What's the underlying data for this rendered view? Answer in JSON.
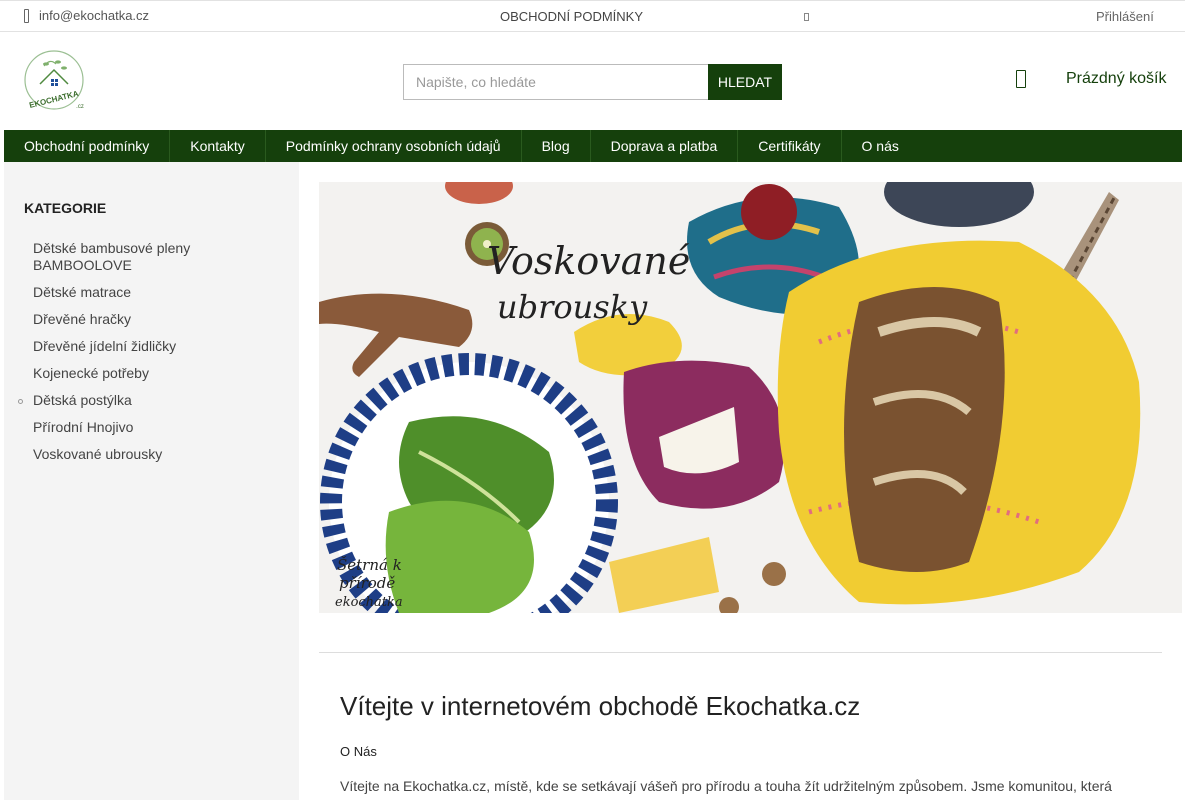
{
  "topbar": {
    "email": "info@ekochatka.cz",
    "terms_link": "OBCHODNÍ PODMÍNKY",
    "login": "Přihlášení"
  },
  "header": {
    "logo_text": "EKOCHATKA",
    "logo_suffix": ".cz",
    "search_placeholder": "Napište, co hledáte",
    "search_button": "HLEDAT",
    "cart_label": "Prázdný košík"
  },
  "nav": {
    "items": [
      "Obchodní podmínky",
      "Kontakty",
      "Podmínky ochrany osobních údajů",
      "Blog",
      "Doprava a platba",
      "Certifikáty",
      "O nás"
    ]
  },
  "sidebar": {
    "heading": "KATEGORIE",
    "categories": [
      "Dětské bambusové pleny BAMBOOLOVE",
      "Dětské matrace",
      "Dřevěné hračky",
      "Dřevěné jídelní židličky",
      "Kojenecké potřeby",
      "Dětská postýlka",
      "Přírodní Hnojivo",
      "Voskované ubrousky"
    ]
  },
  "banner": {
    "title_line1": "Voskované",
    "title_line2": "ubrousky",
    "tag_line1": "Šetrná k",
    "tag_line2": "přírodě",
    "tag_line3": "ekochatka"
  },
  "welcome": {
    "title": "Vítejte v internetovém obchodě Ekochatka.cz",
    "subtitle": "O Nás",
    "text": "Vítejte na Ekochatka.cz, místě, kde se setkávají vášeň pro přírodu a touha žít udržitelným způsobem. Jsme komunitou, která"
  },
  "colors": {
    "brand_green": "#15400c",
    "sidebar_bg": "#f4f4f4"
  }
}
